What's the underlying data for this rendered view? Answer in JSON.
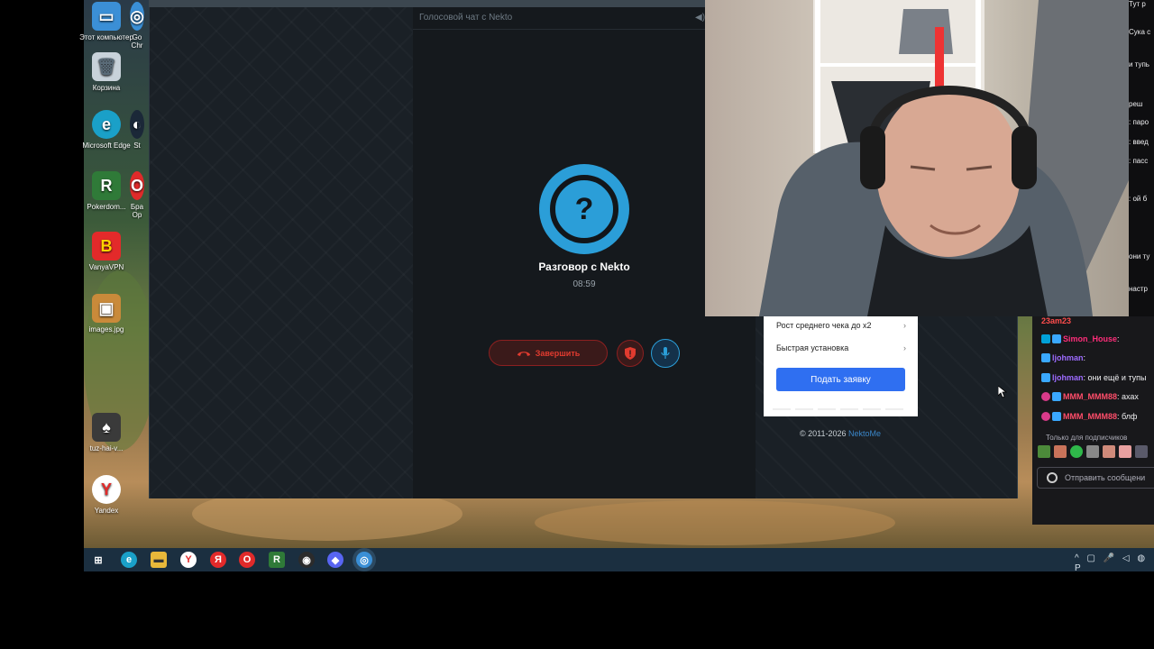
{
  "desktop": {
    "icons": [
      {
        "label": "Этот компьютер",
        "color": "#3b8fd6",
        "glyph": "▭"
      },
      {
        "label": "Корзина",
        "color": "#c8d2da",
        "glyph": "🗑"
      },
      {
        "label": "Microsoft Edge",
        "color": "#1aa0c8",
        "glyph": "e"
      },
      {
        "label": "Pokerdom...",
        "color": "#2f7a38",
        "glyph": "R"
      },
      {
        "label": "VanyaVPN",
        "color": "#e32a2a",
        "glyph": "B"
      },
      {
        "label": "images.jpg",
        "color": "#c98a3a",
        "glyph": "▣"
      },
      {
        "label": "tuz-hai-v...",
        "color": "#3a3a3a",
        "glyph": "♠"
      },
      {
        "label": "Yandex",
        "color": "#ffffff",
        "glyph": "Y"
      }
    ],
    "partial_icons": [
      "Go Chr",
      "St",
      "Бра Op"
    ]
  },
  "call": {
    "window_title": "Голосовой чат с Nekto",
    "speaker_icon": "speaker-icon",
    "avatar_glyph": "?",
    "title": "Разговор с Nekto",
    "timer": "08:59",
    "end_label": "Завершить",
    "colors": {
      "accent": "#2b9ed8",
      "danger": "#e13b2f"
    }
  },
  "card": {
    "items": [
      {
        "label": "Рост среднего чека до х2",
        "chevron": "›"
      },
      {
        "label": "Быстрая установка",
        "chevron": "›"
      }
    ],
    "apply_label": "Подать заявку",
    "copyright_prefix": "© 2011-2026",
    "copyright_link": "NektoMe"
  },
  "chat": {
    "partial_lines": [
      "Тут р",
      "Сука с",
      "и тупь",
      "реш",
      ": паро",
      ": введ",
      ": пасс",
      ": ой б",
      "они ту",
      "настр"
    ],
    "messages": [
      {
        "user": "23am23",
        "text": "",
        "color": "#ff4d4d"
      },
      {
        "user": "Simon_House",
        "text": ":",
        "color": "#ff2d7a"
      },
      {
        "user": "ljohman",
        "text": ":",
        "color": "#3aa8ff"
      },
      {
        "user": "ljohman",
        "text": ": они ещё и тупы",
        "color": "#9d6bff"
      },
      {
        "user": "MMM_MMM88",
        "text": ": ахах",
        "color": "#ff4d6a"
      },
      {
        "user": "MMM_MMM88",
        "text": ": блф",
        "color": "#ff4d6a"
      }
    ],
    "sub_only": "Только для подписчиков",
    "input_placeholder": "Отправить сообщени"
  },
  "taskbar": {
    "apps": [
      {
        "name": "windows-start",
        "glyph": "⊞",
        "color": "#1b2f40"
      },
      {
        "name": "edge",
        "glyph": "e",
        "color": "#1aa0c8"
      },
      {
        "name": "explorer",
        "glyph": "▬",
        "color": "#e8b83a"
      },
      {
        "name": "yandex",
        "glyph": "Y",
        "color": "#e32a2a"
      },
      {
        "name": "yandex-browser",
        "glyph": "Я",
        "color": "#e32a2a"
      },
      {
        "name": "opera",
        "glyph": "O",
        "color": "#e02a2a"
      },
      {
        "name": "pokerdom",
        "glyph": "R",
        "color": "#2f7a38"
      },
      {
        "name": "obs",
        "glyph": "◉",
        "color": "#2b2b2b"
      },
      {
        "name": "discord",
        "glyph": "◆",
        "color": "#5865f2"
      },
      {
        "name": "chrome",
        "glyph": "◎",
        "color": "#3a8fd6"
      }
    ],
    "tray": "^ ▢ 🎤 ◁ ◍ Р"
  }
}
